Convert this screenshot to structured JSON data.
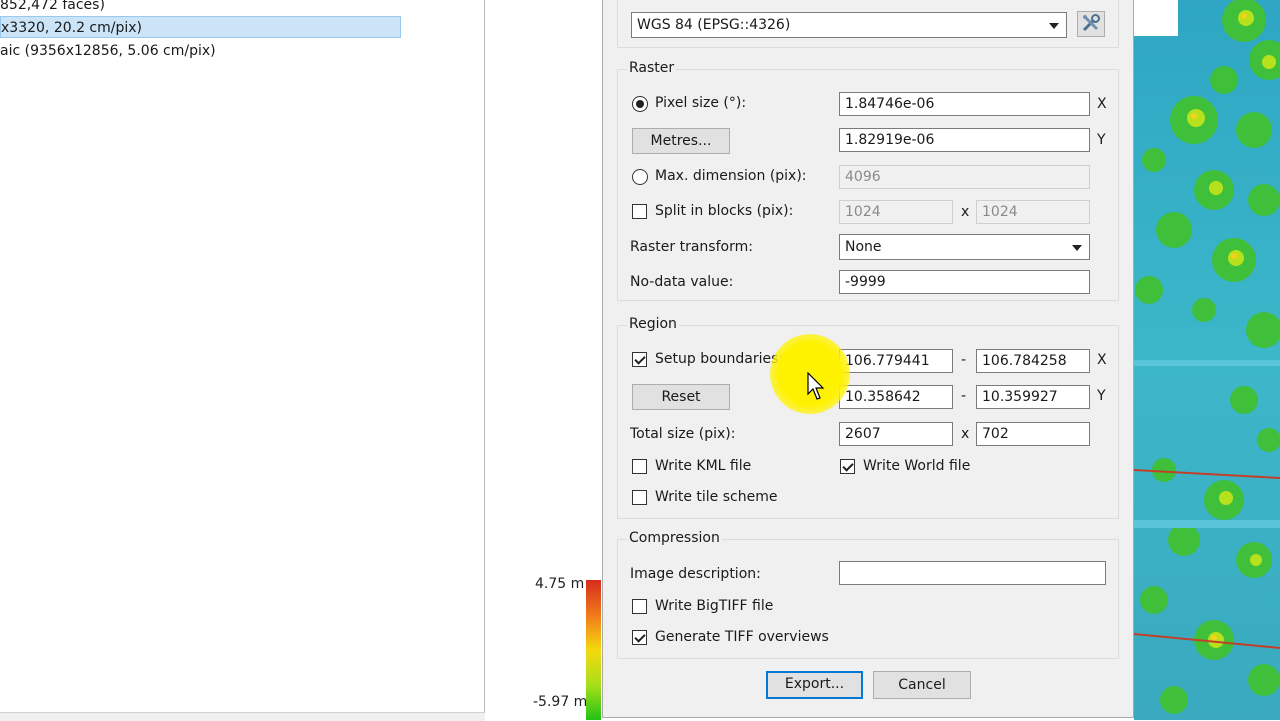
{
  "tree": {
    "items": [
      {
        "label": "852,472 faces)"
      },
      {
        "label": "x3320, 20.2 cm/pix)"
      },
      {
        "label": "aic (9356x12856, 5.06 cm/pix)"
      }
    ]
  },
  "scale": {
    "max_label": "4.75 m",
    "min_label": "-5.97 m"
  },
  "dialog": {
    "crs": {
      "value": "WGS 84 (EPSG::4326)"
    },
    "raster": {
      "title": "Raster",
      "pixel_size_label": "Pixel size (°):",
      "pixel_size_x": "1.84746e-06",
      "pixel_size_y": "1.82919e-06",
      "metres_button": "Metres...",
      "max_dimension_label": "Max. dimension (pix):",
      "max_dimension_value": "4096",
      "split_blocks_label": "Split in blocks (pix):",
      "split_w": "1024",
      "split_h": "1024",
      "raster_transform_label": "Raster transform:",
      "raster_transform_value": "None",
      "nodata_label": "No-data value:",
      "nodata_value": "-9999",
      "axis_x": "X",
      "axis_y": "Y",
      "times": "x"
    },
    "region": {
      "title": "Region",
      "setup_boundaries_label": "Setup boundaries:",
      "x_min": "106.779441",
      "x_max": "106.784258",
      "y_min": "10.358642",
      "y_max": "10.359927",
      "dash": "-",
      "reset_button": "Reset",
      "total_size_label": "Total size (pix):",
      "total_w": "2607",
      "total_h": "702",
      "write_kml_label": "Write KML file",
      "write_world_label": "Write World file",
      "write_tile_label": "Write tile scheme"
    },
    "compression": {
      "title": "Compression",
      "image_desc_label": "Image description:",
      "image_desc_value": "",
      "bigtiff_label": "Write BigTIFF file",
      "overviews_label": "Generate TIFF overviews"
    },
    "export_button": "Export...",
    "cancel_button": "Cancel"
  },
  "colors": {
    "selection": "#cce4f7",
    "accent": "#0078d7",
    "cursor_highlight": "#fff200"
  }
}
